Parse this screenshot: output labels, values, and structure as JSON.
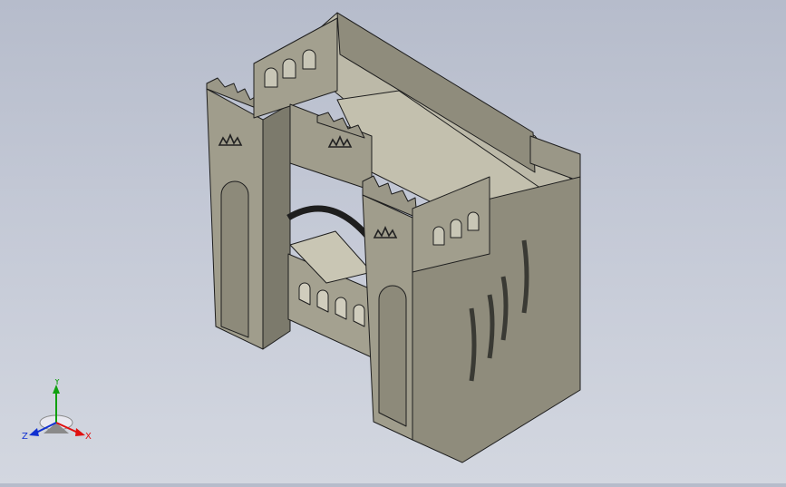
{
  "viewport": {
    "background_top": "#b6bccb",
    "background_bottom": "#d3d7e0",
    "model": {
      "panel_color": "#9a9787",
      "panel_shadow": "#6f6c5f",
      "panel_light": "#b0ad9c",
      "floor_color": "#bcb9a8",
      "edge_color": "#1e1e1e",
      "crown_icon": "crown-icon"
    }
  },
  "triad": {
    "x_label": "X",
    "y_label": "Y",
    "z_label": "Z",
    "x_color": "#e01010",
    "y_color": "#10a010",
    "z_color": "#1030d0"
  }
}
